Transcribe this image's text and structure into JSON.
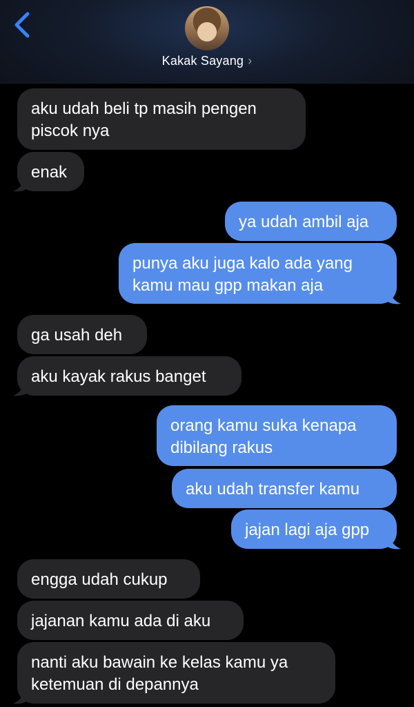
{
  "header": {
    "contact_name": "Kakak Sayang",
    "chevron": "›"
  },
  "messages": [
    {
      "side": "received",
      "lines": [
        "aku udah beli tp masih pengen",
        "piscok nya"
      ]
    },
    {
      "side": "received",
      "lines": [
        "enak"
      ]
    },
    {
      "side": "sent",
      "lines": [
        "ya udah ambil aja"
      ]
    },
    {
      "side": "sent",
      "lines": [
        "punya aku juga kalo ada yang",
        "kamu mau gpp makan aja"
      ]
    },
    {
      "side": "received",
      "lines": [
        "ga usah deh"
      ]
    },
    {
      "side": "received",
      "lines": [
        "aku kayak rakus banget"
      ]
    },
    {
      "side": "sent",
      "lines": [
        "orang kamu suka kenapa",
        "dibilang rakus"
      ]
    },
    {
      "side": "sent",
      "lines": [
        "aku udah transfer kamu"
      ]
    },
    {
      "side": "sent",
      "lines": [
        "jajan lagi aja gpp"
      ]
    },
    {
      "side": "received",
      "lines": [
        "engga udah cukup"
      ]
    },
    {
      "side": "received",
      "lines": [
        "jajanan kamu ada di aku"
      ]
    },
    {
      "side": "received",
      "lines": [
        "nanti aku bawain ke kelas kamu ya",
        "ketemuan di depannya"
      ]
    }
  ],
  "colors": {
    "accent": "#3a82f7",
    "sent_bubble": "#568dea",
    "received_bubble": "#262629",
    "background": "#000000"
  },
  "icons": {
    "back": "chevron-left-icon",
    "contact_details": "chevron-right-icon"
  }
}
